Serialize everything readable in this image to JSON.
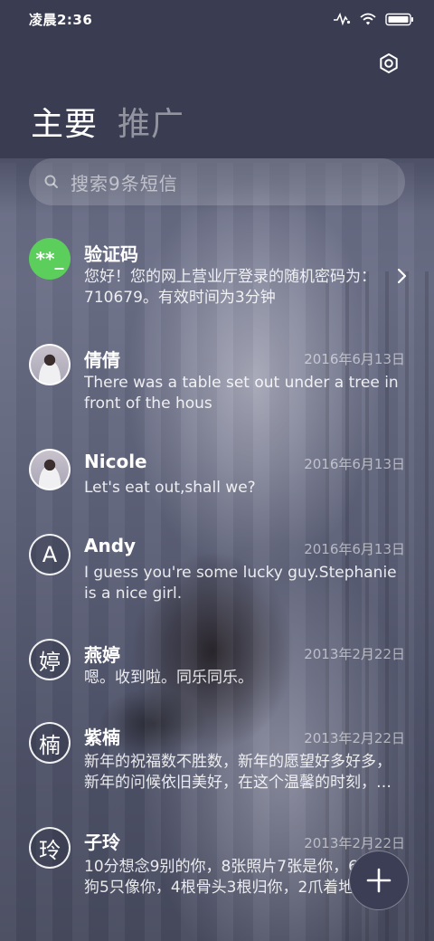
{
  "status_bar": {
    "time": "凌晨2:36",
    "icons": [
      "signal-activity-icon",
      "wifi-icon",
      "battery-icon"
    ]
  },
  "header": {
    "settings_icon": "settings-icon",
    "tabs": [
      {
        "label": "主要",
        "active": true
      },
      {
        "label": "推广",
        "active": false
      }
    ]
  },
  "search": {
    "placeholder": "搜索9条短信"
  },
  "messages": [
    {
      "avatar_type": "code",
      "avatar_text": "**_",
      "name": "验证码",
      "date": "",
      "preview": "您好！您的网上营业厅登录的随机密码为：710679。有效时间为3分钟",
      "has_chevron": true
    },
    {
      "avatar_type": "photo",
      "avatar_text": "",
      "name": "倩倩",
      "date": "2016年6月13日",
      "preview": "There was a table set out under a tree in front of the hous"
    },
    {
      "avatar_type": "photo",
      "avatar_text": "",
      "name": "Nicole",
      "date": "2016年6月13日",
      "preview": "Let's eat out,shall we?"
    },
    {
      "avatar_type": "letter",
      "avatar_text": "A",
      "name": "Andy",
      "date": "2016年6月13日",
      "preview": "I guess you're some lucky guy.Stephanie is a nice girl."
    },
    {
      "avatar_type": "letter",
      "avatar_text": "婷",
      "name": "燕婷",
      "date": "2013年2月22日",
      "preview": "嗯。收到啦。同乐同乐。"
    },
    {
      "avatar_type": "letter",
      "avatar_text": "楠",
      "name": "紫楠",
      "date": "2013年2月22日",
      "preview": "新年的祝福数不胜数，新年的愿望好多好多，新年的问候依旧美好，在这个温馨的时刻，…"
    },
    {
      "avatar_type": "letter",
      "avatar_text": "玲",
      "name": "子玲",
      "date": "2013年2月22日",
      "preview": "10分想念9别的你，8张照片7张是你，6只小狗5只像你，4根骨头3根归你，2爪着地"
    }
  ],
  "fab": {
    "icon": "plus-icon"
  },
  "colors": {
    "header_bg": "#3a3d52",
    "code_avatar": "#5cce5c",
    "fab_bg": "#3b3e55"
  }
}
